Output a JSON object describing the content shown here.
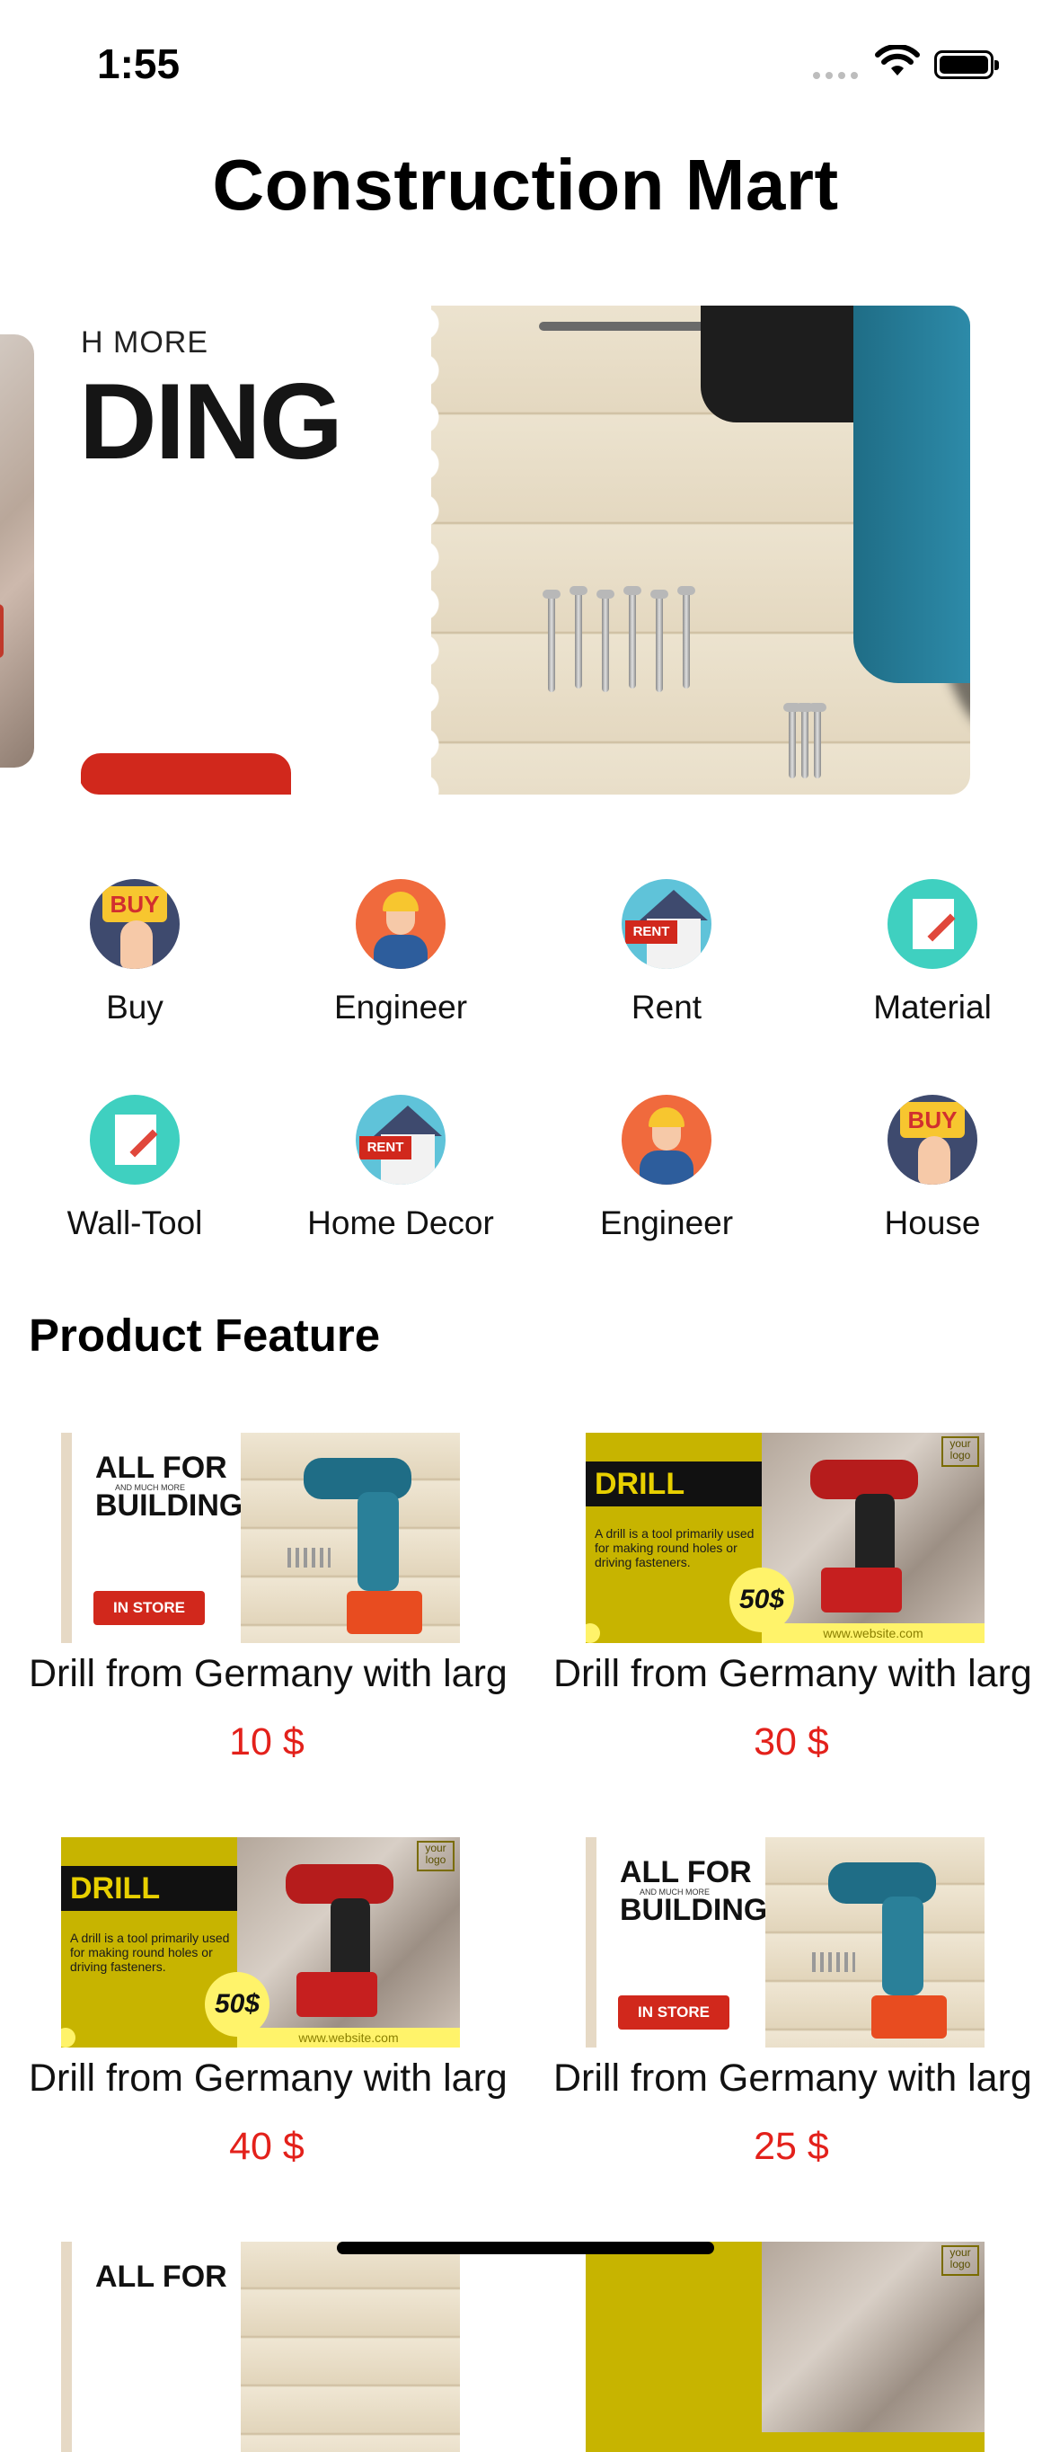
{
  "status_bar": {
    "time": "1:55"
  },
  "app": {
    "title": "Construction Mart"
  },
  "banner": {
    "small_text": "H MORE",
    "big_text": "DING"
  },
  "categories": [
    {
      "label": "Buy",
      "icon": "buy-icon"
    },
    {
      "label": "Engineer",
      "icon": "engineer-icon"
    },
    {
      "label": "Rent",
      "icon": "rent-icon"
    },
    {
      "label": "Material",
      "icon": "material-icon"
    },
    {
      "label": "Wall-Tool",
      "icon": "material-icon"
    },
    {
      "label": "Home Decor",
      "icon": "rent-icon"
    },
    {
      "label": "Engineer",
      "icon": "engineer-icon"
    },
    {
      "label": "House",
      "icon": "buy-icon"
    }
  ],
  "icon_text": {
    "buy": "BUY",
    "rent": "RENT"
  },
  "section": {
    "title": "Product Feature"
  },
  "promo_a": {
    "line1": "ALL FOR",
    "line0": "AND MUCH MORE",
    "line2": "BUILDING",
    "button": "IN STORE"
  },
  "promo_b": {
    "heading": "DRILL",
    "desc": "A drill is a tool primarily used for making round holes or driving fasteners.",
    "badge": "50$",
    "url": "www.website.com",
    "logo": "your logo"
  },
  "products": [
    {
      "name": "Drill from Germany with large capacity",
      "price": "10 $",
      "image": "promo-a"
    },
    {
      "name": "Drill from Germany with large capacity",
      "price": "30 $",
      "image": "promo-b"
    },
    {
      "name": "Drill from Germany with large capacity",
      "price": "40 $",
      "image": "promo-b"
    },
    {
      "name": "Drill from Germany with large capacity",
      "price": "25 $",
      "image": "promo-a"
    }
  ],
  "colors": {
    "price": "#e3211b",
    "accent_red": "#d1281c",
    "promo_yellow": "#c7b400"
  }
}
